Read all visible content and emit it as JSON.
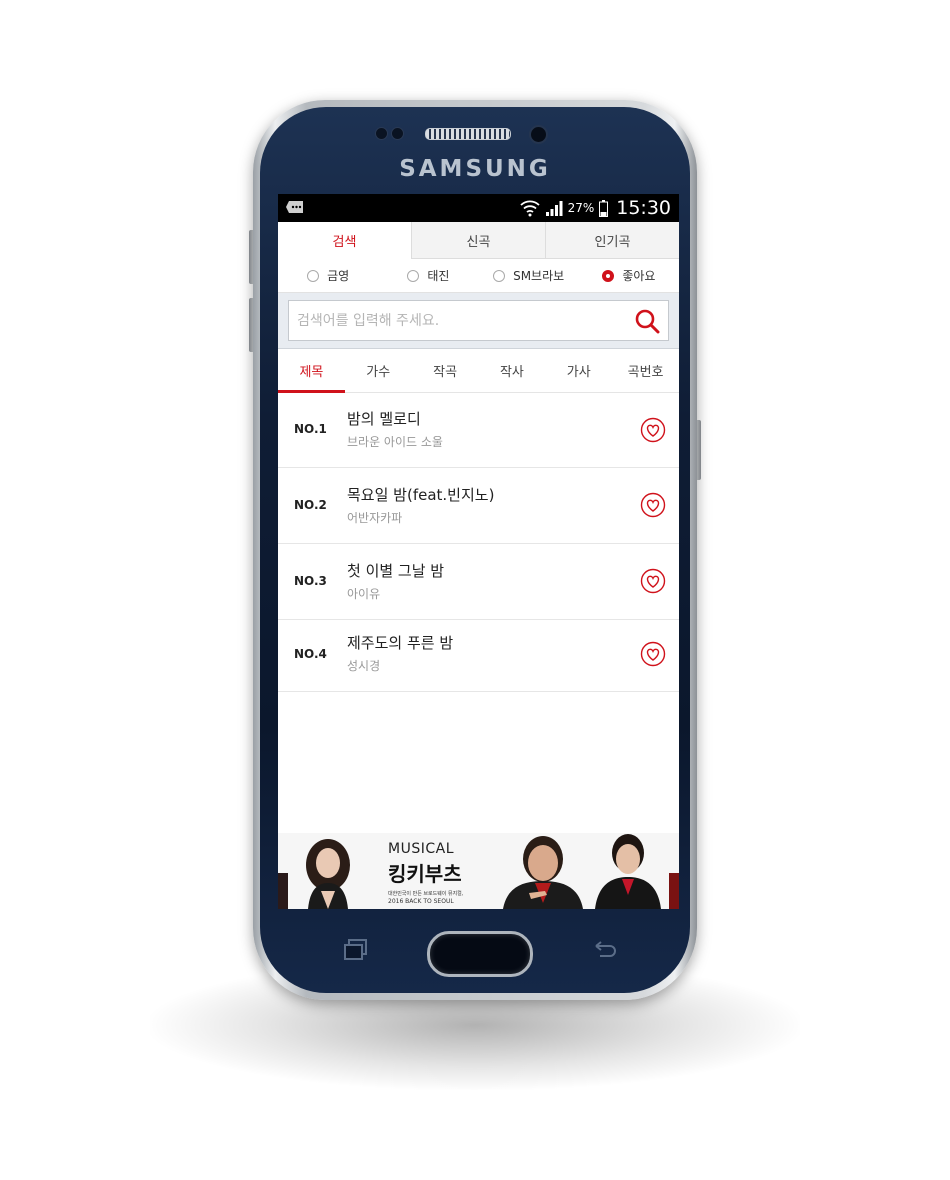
{
  "device": {
    "brand": "SAMSUNG"
  },
  "status_bar": {
    "battery": "27%",
    "time": "15:30"
  },
  "tabs": [
    {
      "label": "검색",
      "active": true
    },
    {
      "label": "신곡",
      "active": false
    },
    {
      "label": "인기곡",
      "active": false
    }
  ],
  "sources": [
    {
      "label": "금영",
      "selected": false
    },
    {
      "label": "태진",
      "selected": false
    },
    {
      "label": "SM브라보",
      "selected": false
    },
    {
      "label": "좋아요",
      "selected": true
    }
  ],
  "search": {
    "placeholder": "검색어를 입력해 주세요.",
    "value": ""
  },
  "categories": [
    {
      "label": "제목",
      "active": true
    },
    {
      "label": "가수",
      "active": false
    },
    {
      "label": "작곡",
      "active": false
    },
    {
      "label": "작사",
      "active": false
    },
    {
      "label": "가사",
      "active": false
    },
    {
      "label": "곡번호",
      "active": false
    }
  ],
  "songs": [
    {
      "rank": "NO.1",
      "title": "밤의 멜로디",
      "artist": "브라운 아이드 소울"
    },
    {
      "rank": "NO.2",
      "title": "목요일 밤(feat.빈지노)",
      "artist": "어반자카파"
    },
    {
      "rank": "NO.3",
      "title": "첫 이별 그날 밤",
      "artist": "아이유"
    },
    {
      "rank": "NO.4",
      "title": "제주도의 푸른 밤",
      "artist": "성시경"
    }
  ],
  "ad": {
    "label": "MUSICAL",
    "title": "킹키부츠",
    "line1": "대한민국이 만든 브로드웨이 뮤지컬,",
    "line2": "2016 BACK TO SEOUL"
  },
  "colors": {
    "accent": "#d0121b",
    "phone_body": "#0f1d35"
  },
  "icons": {
    "search": "search-icon",
    "heart": "heart-icon",
    "message": "message-icon",
    "wifi": "wifi-icon",
    "signal": "signal-icon",
    "battery": "battery-icon",
    "recent": "recent-apps-icon",
    "back": "back-icon"
  }
}
